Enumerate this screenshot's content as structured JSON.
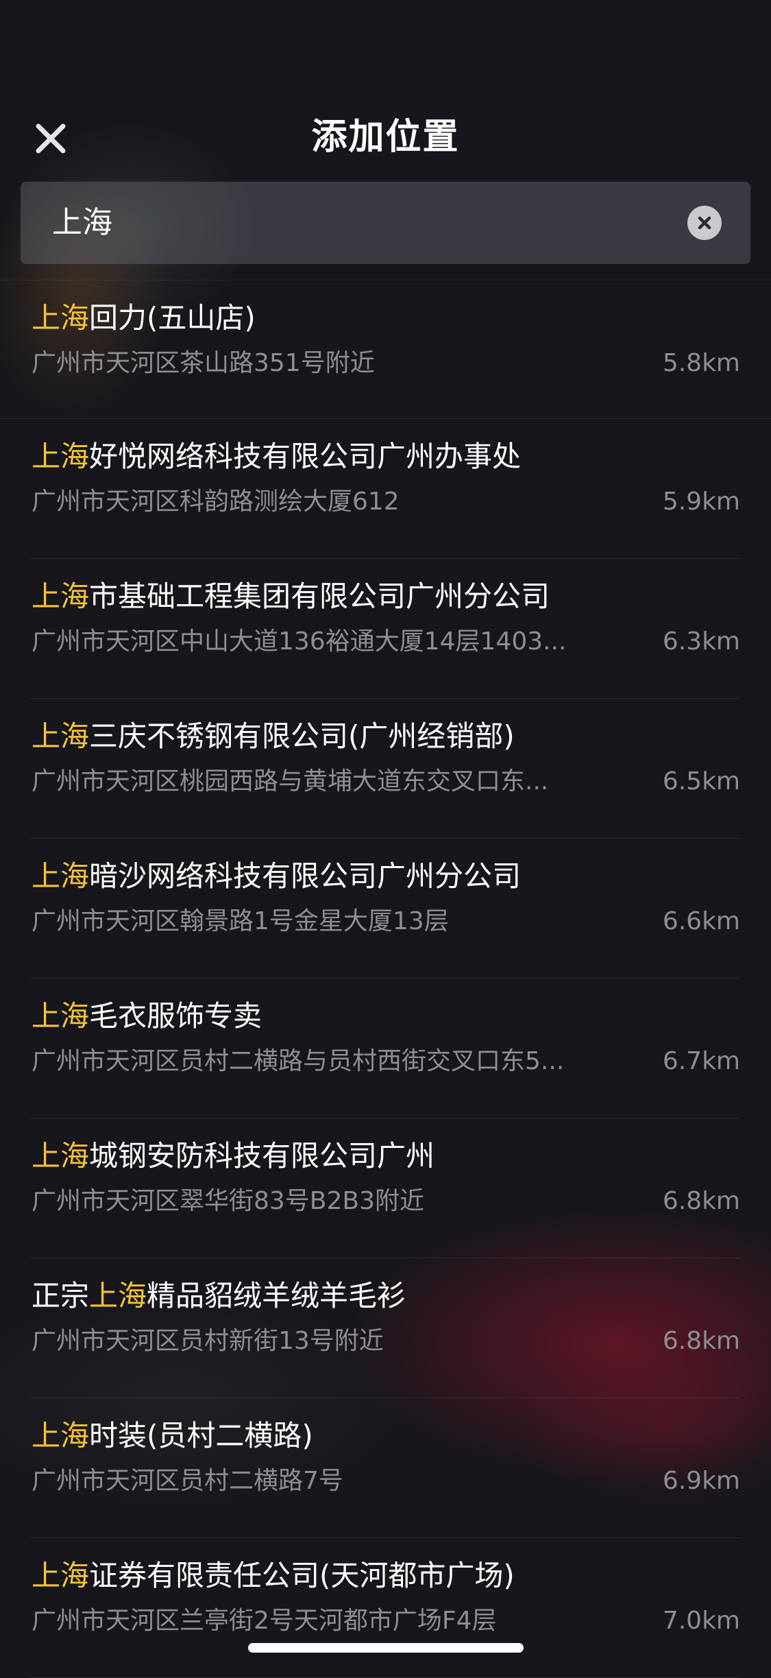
{
  "header": {
    "title": "添加位置",
    "close_icon": "close-icon"
  },
  "search": {
    "value": "上海",
    "clear_icon": "clear-icon"
  },
  "colors": {
    "background": "#16161c",
    "highlight": "#f7c434",
    "secondary_text": "#8e8f94"
  },
  "results": [
    {
      "prefix": "",
      "highlight": "上海",
      "suffix": "回力(五山店)",
      "address": "广州市天河区茶山路351号附近",
      "distance": "5.8km"
    },
    {
      "prefix": "",
      "highlight": "上海",
      "suffix": "好悦网络科技有限公司广州办事处",
      "address": "广州市天河区科韵路测绘大厦612",
      "distance": "5.9km"
    },
    {
      "prefix": "",
      "highlight": "上海",
      "suffix": "市基础工程集团有限公司广州分公司",
      "address": "广州市天河区中山大道136裕通大厦14层1403...",
      "distance": "6.3km"
    },
    {
      "prefix": "",
      "highlight": "上海",
      "suffix": "三庆不锈钢有限公司(广州经销部)",
      "address": "广州市天河区桃园西路与黄埔大道东交叉口东...",
      "distance": "6.5km"
    },
    {
      "prefix": "",
      "highlight": "上海",
      "suffix": "暗沙网络科技有限公司广州分公司",
      "address": "广州市天河区翰景路1号金星大厦13层",
      "distance": "6.6km"
    },
    {
      "prefix": "",
      "highlight": "上海",
      "suffix": "毛衣服饰专卖",
      "address": "广州市天河区员村二横路与员村西街交叉口东5...",
      "distance": "6.7km"
    },
    {
      "prefix": "",
      "highlight": "上海",
      "suffix": "城钢安防科技有限公司广州",
      "address": "广州市天河区翠华街83号B2B3附近",
      "distance": "6.8km"
    },
    {
      "prefix": "正宗",
      "highlight": "上海",
      "suffix": "精品貂绒羊绒羊毛衫",
      "address": "广州市天河区员村新街13号附近",
      "distance": "6.8km"
    },
    {
      "prefix": "",
      "highlight": "上海",
      "suffix": "时装(员村二横路)",
      "address": "广州市天河区员村二横路7号",
      "distance": "6.9km"
    },
    {
      "prefix": "",
      "highlight": "上海",
      "suffix": "证券有限责任公司(天河都市广场)",
      "address": "广州市天河区兰亭街2号天河都市广场F4层",
      "distance": "7.0km"
    }
  ]
}
